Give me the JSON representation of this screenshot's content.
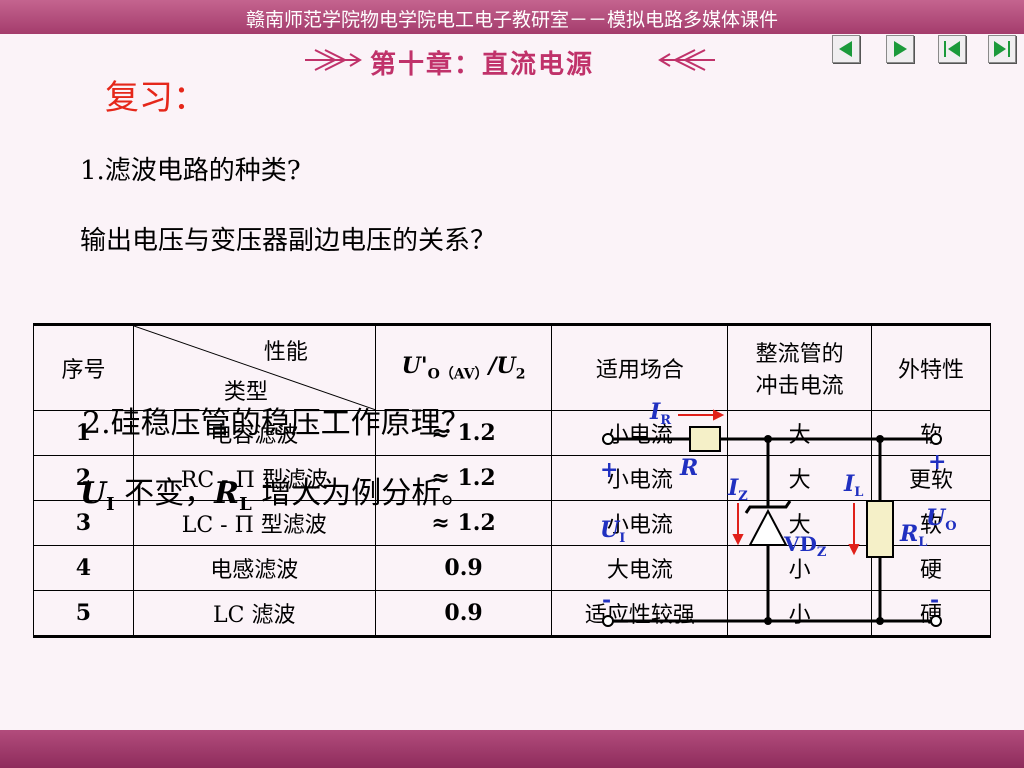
{
  "header": {
    "title": "赣南师范学院物电学院电工电子教研室－－模拟电路多媒体课件"
  },
  "banner": {
    "chapter_title": "第十章：直流电源"
  },
  "nav": {
    "prev": "◀",
    "next": "▶",
    "first": "|◀",
    "last": "▶|"
  },
  "content": {
    "heading": "复习：",
    "q1": "1.滤波电路的种类?",
    "q2": "输出电压与变压器副边电压的关系？",
    "q3": "2.硅稳压管的稳压工作原理？",
    "q4_sym": "U",
    "q4_sub": "I",
    "q4_mid": " 不变，",
    "q4_sym2": "R",
    "q4_sub2": "L",
    "q4_tail": " 增大为例分析。"
  },
  "table": {
    "headers": {
      "index": "序号",
      "diag_top": "性能",
      "diag_bottom": "类型",
      "ratio_sym": "U'",
      "ratio_sub": "O（AV）",
      "ratio_tail": "/U",
      "ratio_sub2": "2",
      "occasion": "适用场合",
      "surge_l1": "整流管的",
      "surge_l2": "冲击电流",
      "external": "外特性"
    },
    "rows": [
      {
        "index": "1",
        "type": "电容滤波",
        "ratio": "≈ 1.2",
        "occasion": "小电流",
        "surge": "大",
        "external": "软"
      },
      {
        "index": "2",
        "type": "RC - Π 型滤波",
        "ratio": "≈ 1.2",
        "occasion": "小电流",
        "surge": "大",
        "external": "更软"
      },
      {
        "index": "3",
        "type": "LC - Π 型滤波",
        "ratio": "≈ 1.2",
        "occasion": "小电流",
        "surge": "大",
        "external": "软"
      },
      {
        "index": "4",
        "type": "电感滤波",
        "ratio": "0.9",
        "occasion": "大电流",
        "surge": "小",
        "external": "硬"
      },
      {
        "index": "5",
        "type": "LC 滤波",
        "ratio": "0.9",
        "occasion": "适应性较强",
        "surge": "小",
        "external": "硬"
      }
    ]
  },
  "circuit": {
    "IR": "I",
    "IR_sub": "R",
    "R": "R",
    "IZ": "I",
    "IZ_sub": "Z",
    "IL": "I",
    "IL_sub": "L",
    "UI": "U",
    "UI_sub": "I",
    "VDZ": "VD",
    "VDZ_sub": "Z",
    "RL": "R",
    "RL_sub": "L",
    "UO": "U",
    "UO_sub": "O",
    "plus": "+",
    "minus": "-"
  },
  "colors": {
    "accent": "#a43c6c",
    "heading": "#e5271a",
    "circuit_label": "#2030c0",
    "arrow": "#e0201a"
  }
}
